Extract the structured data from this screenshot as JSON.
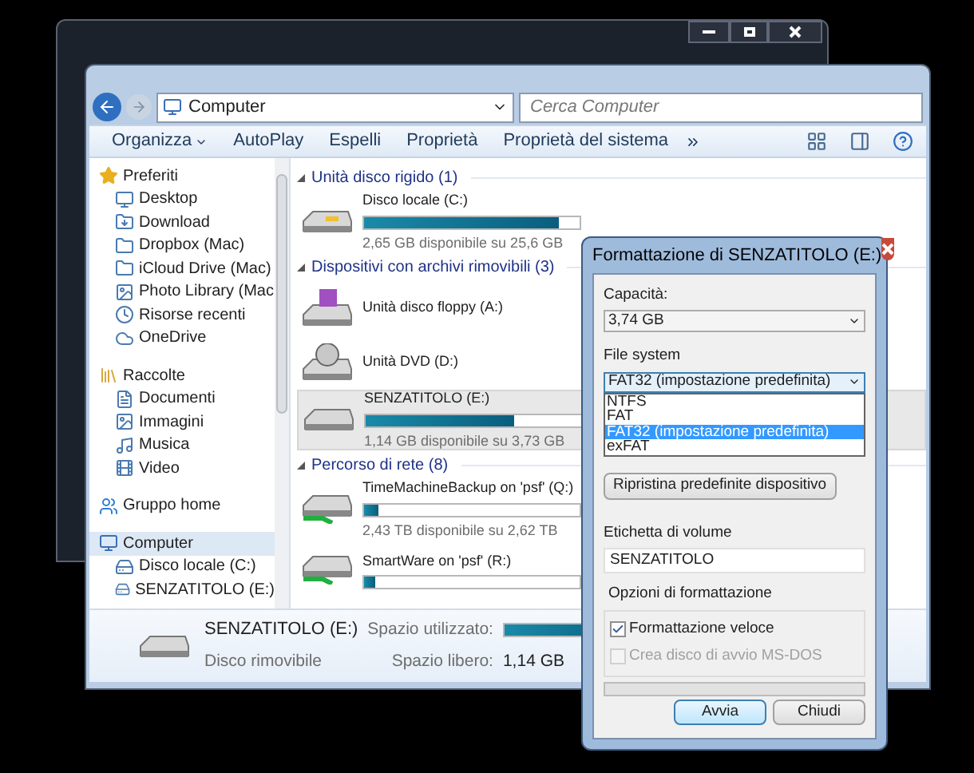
{
  "explorer": {
    "address": {
      "path": "Computer",
      "search_placeholder": "Cerca Computer"
    },
    "toolbar": [
      {
        "label": "Organizza",
        "dropdown": true
      },
      {
        "label": "AutoPlay",
        "dropdown": false
      },
      {
        "label": "Espelli",
        "dropdown": false
      },
      {
        "label": "Proprietà",
        "dropdown": false
      },
      {
        "label": "Proprietà del sistema",
        "dropdown": false
      }
    ],
    "sidebar": [
      {
        "label": "Preferiti",
        "selected": false,
        "children": [
          {
            "label": "Desktop",
            "selected": false
          },
          {
            "label": "Download",
            "selected": false
          },
          {
            "label": "Dropbox (Mac)",
            "selected": false
          },
          {
            "label": "iCloud Drive (Mac)",
            "selected": false
          },
          {
            "label": "Photo Library (Mac",
            "selected": false
          },
          {
            "label": "Risorse recenti",
            "selected": false
          },
          {
            "label": "OneDrive",
            "selected": false
          }
        ]
      },
      {
        "label": "Raccolte",
        "selected": false,
        "children": [
          {
            "label": "Documenti",
            "selected": false
          },
          {
            "label": "Immagini",
            "selected": false
          },
          {
            "label": "Musica",
            "selected": false
          },
          {
            "label": "Video",
            "selected": false
          }
        ]
      },
      {
        "label": "Gruppo home",
        "selected": false
      },
      {
        "label": "Computer",
        "selected": true,
        "children": [
          {
            "label": "Disco locale (C:)",
            "selected": false
          },
          {
            "label": "SENZATITOLO (E:)",
            "selected": false
          }
        ]
      }
    ],
    "groups": [
      {
        "title": "Unità disco rigido (1)",
        "expanded": true,
        "items": [
          {
            "kind": "bar",
            "name": "Disco locale (C:)",
            "level": 0.9,
            "free": "2,65 GB disponibile su 25,6 GB",
            "selected": false
          }
        ]
      },
      {
        "title": "Dispositivi con archivi rimovibili (3)",
        "expanded": true,
        "items": [
          {
            "kind": "plain",
            "name": "Unità disco floppy (A:)",
            "selected": false
          },
          {
            "kind": "plain",
            "name": "Unità DVD (D:)",
            "selected": false
          },
          {
            "kind": "bar",
            "name": "SENZATITOLO (E:)",
            "level": 0.69,
            "free": "1,14 GB disponibile su 3,73 GB",
            "selected": true
          }
        ]
      },
      {
        "title": "Percorso di rete (8)",
        "expanded": true,
        "items": [
          {
            "kind": "bar",
            "name": "TimeMachineBackup on 'psf' (Q:)",
            "level": 0.07,
            "free": "2,43 TB disponibile su 2,62 TB",
            "selected": false
          },
          {
            "kind": "bar",
            "name": "SmartWare on 'psf' (R:)",
            "level": 0.05,
            "selected": false
          }
        ]
      }
    ],
    "details": {
      "name": "SENZATITOLO (E:)",
      "type": "Disco rimovibile",
      "used": {
        "label": "Spazio utilizzato:",
        "level": 0.69
      },
      "free": {
        "label": "Spazio libero:",
        "value": "1,14 GB"
      }
    }
  },
  "dialog": {
    "title": "Formattazione di SENZATITOLO (E:)",
    "capacity": {
      "label": "Capacità:",
      "value": "3,74 GB"
    },
    "file_system": {
      "label": "File system",
      "value": "FAT32 (impostazione predefinita)",
      "expanded": true,
      "options": [
        {
          "label": "NTFS",
          "selected": false
        },
        {
          "label": "FAT",
          "selected": false
        },
        {
          "label": "FAT32 (impostazione predefinita)",
          "selected": true
        },
        {
          "label": "exFAT",
          "selected": false
        }
      ]
    },
    "restore_button": "Ripristina predefinite dispositivo",
    "volume_label": {
      "label": "Etichetta di volume",
      "value": "SENZATITOLO"
    },
    "options": {
      "title": "Opzioni di formattazione",
      "items": [
        {
          "label": "Formattazione veloce",
          "checked": true,
          "disabled": false
        },
        {
          "label": "Crea disco di avvio MS-DOS",
          "checked": false,
          "disabled": true
        }
      ]
    },
    "progress": {
      "level": 0
    },
    "buttons": [
      {
        "label": "Avvia",
        "default": true
      },
      {
        "label": "Chiudi",
        "default": false
      }
    ]
  }
}
